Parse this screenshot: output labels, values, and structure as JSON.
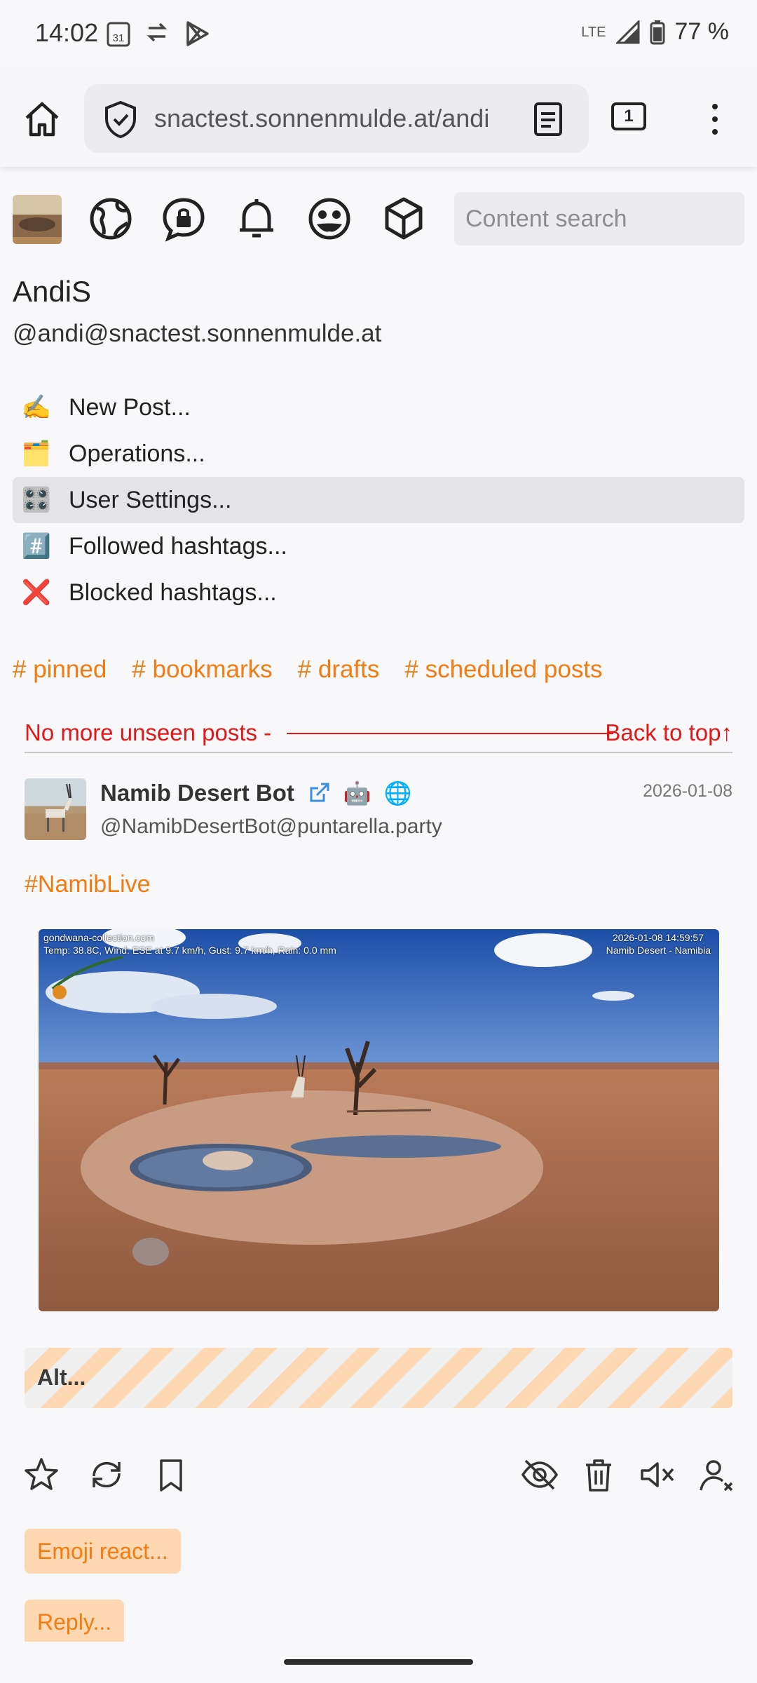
{
  "status_bar": {
    "time": "14:02",
    "calendar_day": "31",
    "network": "LTE",
    "battery": "77 %"
  },
  "browser": {
    "url": "snactest.sonnenmulde.at/andi",
    "tab_count": "1"
  },
  "search": {
    "placeholder": "Content search"
  },
  "profile": {
    "display_name": "AndiS",
    "handle": "@andi@snactest.sonnenmulde.at"
  },
  "menu": [
    {
      "emoji": "✍️",
      "label": "New Post..."
    },
    {
      "emoji": "🗂️",
      "label": "Operations..."
    },
    {
      "emoji": "🎛️",
      "label": "User Settings..."
    },
    {
      "emoji": "#️⃣",
      "label": "Followed hashtags..."
    },
    {
      "emoji": "❌",
      "label": "Blocked hashtags..."
    }
  ],
  "tags": [
    "# pinned",
    "# bookmarks",
    "# drafts",
    "# scheduled posts"
  ],
  "timeline": {
    "no_more": "No more unseen posts -",
    "back_to_top": "Back to top↑"
  },
  "post": {
    "author": "Namib Desert Bot",
    "bot_emoji": "🤖",
    "globe_emoji": "🌐",
    "handle": "@NamibDesertBot@puntarella.party",
    "date": "2026-01-08",
    "hashtag": "#NamibLive",
    "image_overlay": {
      "site": "gondwana-collection.com",
      "weather": "Temp: 38.8C, Wind: ESE at 9.7 km/h, Gust: 9.7 km/h, Rain: 0.0 mm",
      "timestamp": "2026-01-08 14:59:57",
      "location": "Namib Desert - Namibia"
    },
    "alt_label": "Alt...",
    "emoji_react": "Emoji react...",
    "reply": "Reply..."
  },
  "colors": {
    "accent": "#f07c12",
    "alert": "#e01818",
    "pill_bg": "#fdd8b2"
  }
}
